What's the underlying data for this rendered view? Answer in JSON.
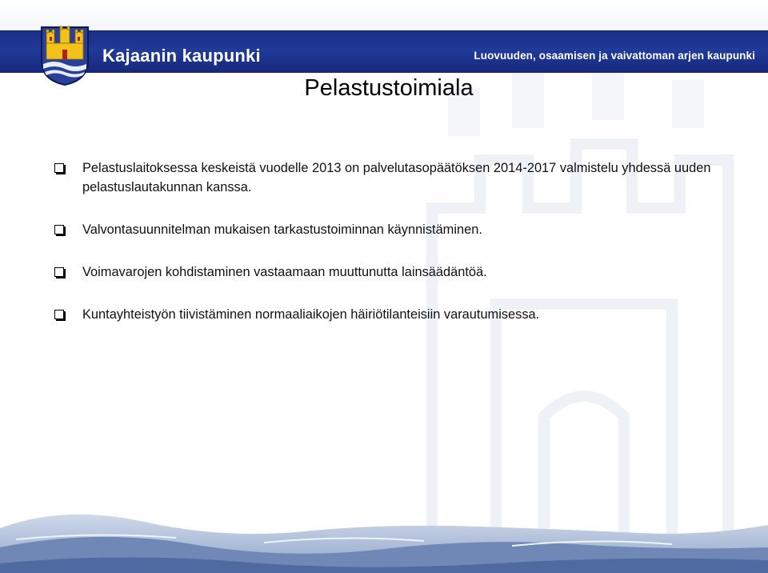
{
  "header": {
    "org_name": "Kajaanin kaupunki",
    "slogan": "Luovuuden, osaamisen ja vaivattoman arjen kaupunki",
    "band_color": "#1a2f86",
    "crest_icon": "castle-coat-of-arms-icon"
  },
  "slide": {
    "title": "Pelastustoimiala",
    "bullets": [
      {
        "text": "Pelastuslaitoksessa keskeistä vuodelle 2013 on palvelutasopäätöksen 2014-2017 valmistelu yhdessä uuden pelastuslautakunnan kanssa."
      },
      {
        "text": "Valvontasuunnitelman mukaisen tarkastustoiminnan käynnistäminen."
      },
      {
        "text": "Voimavarojen kohdistaminen vastaamaan muuttunutta lainsäädäntöä."
      },
      {
        "text": "Kuntayhteistyön tiivistäminen normaaliaikojen häiriötilanteisiin varautumisessa."
      }
    ],
    "bullet_icon": "checkbox-square-icon"
  }
}
